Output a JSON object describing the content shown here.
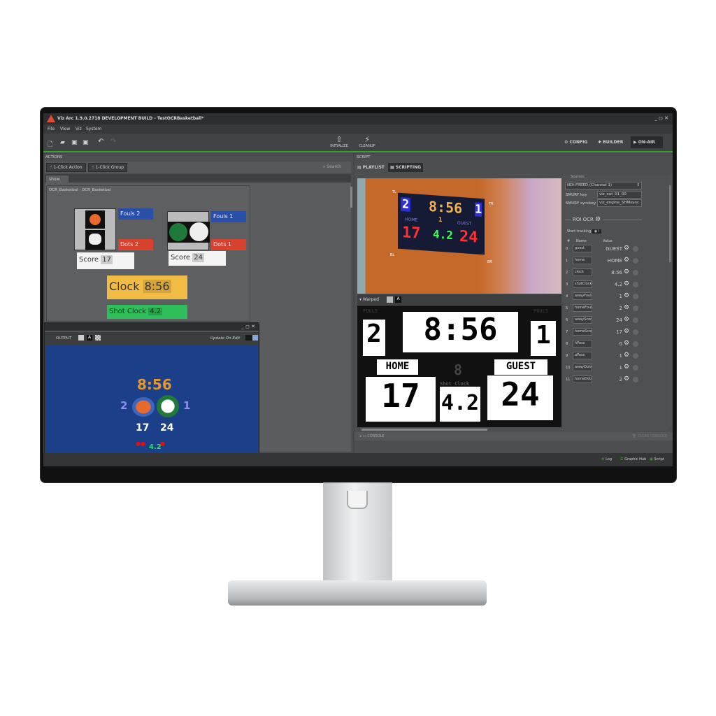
{
  "window": {
    "title": "Viz Arc 1.9.0.2718 DEVELOPMENT BUILD - TestOCRBasketball*",
    "controls": "_ ◻ ✕"
  },
  "menu": [
    "File",
    "View",
    "Viz",
    "System"
  ],
  "toolbar": {
    "initialize": "INITIALIZE",
    "cleanup": "CLEANUP",
    "config": "CONFIG",
    "builder": "BUILDER",
    "on_air": "ON-AIR"
  },
  "actions": {
    "header": "ACTIONS",
    "one_click_action": "1-Click Action",
    "one_click_group": "1-Click Group",
    "search_placeholder": "Search",
    "tab": "show",
    "breadcrumb": "OCR_Basketbal  ·  OCR_Basketbal",
    "home": {
      "fouls_label": "Fouls",
      "fouls": "2",
      "dots_label": "Dots",
      "dots": "2",
      "score_label": "Score",
      "score": "17"
    },
    "guest": {
      "fouls_label": "Fouls",
      "fouls": "1",
      "dots_label": "Dots",
      "dots": "1",
      "score_label": "Score",
      "score": "24"
    },
    "clock_label": "Clock",
    "clock": "8:56",
    "shot_clock_label": "Shot Clock",
    "shot_clock": "4.2"
  },
  "output": {
    "label": "OUTPUT",
    "update_on_edit": "Update On-Edit",
    "clock": "8:56",
    "home_fouls": "2",
    "guest_fouls": "1",
    "home_score": "17",
    "guest_score": "24",
    "shot_clock": "4.2"
  },
  "script": {
    "header": "SCRIPT",
    "playlist": "PLAYLIST",
    "scripting": "SCRIPTING",
    "sources_label": "Sources",
    "source": "NDI-FREED (Channel 1)",
    "smurf_key_label": "SMURF key",
    "smurf_key": "viz_out_01_00",
    "smurf_synckey_label": "SMURF synckey",
    "smurf_synckey": "viz_engine_SHMsync",
    "roi_title": "ROI OCR",
    "start_tracking": "Start tracking",
    "col_num": "#",
    "col_name": "Name",
    "col_value": "Value",
    "rois": [
      {
        "n": "0",
        "name": "guest",
        "value": "GUEST"
      },
      {
        "n": "1",
        "name": "home",
        "value": "HOME"
      },
      {
        "n": "2",
        "name": "clock",
        "value": "8:56"
      },
      {
        "n": "3",
        "name": "shotClock",
        "value": "4.2"
      },
      {
        "n": "4",
        "name": "awayFouls",
        "value": "1"
      },
      {
        "n": "5",
        "name": "homeFouls",
        "value": "2"
      },
      {
        "n": "6",
        "name": "awayScore",
        "value": "24"
      },
      {
        "n": "7",
        "name": "homeScore",
        "value": "17"
      },
      {
        "n": "8",
        "name": "hPoss",
        "value": "0"
      },
      {
        "n": "9",
        "name": "aPoss",
        "value": "1"
      },
      {
        "n": "10",
        "name": "awayDots",
        "value": "1"
      },
      {
        "n": "11",
        "name": "homeDots",
        "value": "2"
      }
    ],
    "camera": {
      "corners": [
        "TL",
        "TR",
        "BL",
        "BR"
      ],
      "home_fouls": "2",
      "clock": "8:56",
      "guest_fouls": "1",
      "home": "HOME",
      "guest": "GUEST",
      "period": "1",
      "home_score": "17",
      "shot_clock": "4.2",
      "guest_score": "24"
    },
    "warped": {
      "label": "Warped",
      "fouls": "FOULS",
      "home_fouls": "2",
      "clock": "8:56",
      "guest_fouls": "1",
      "home": "HOME",
      "guest": "GUEST",
      "period": "8",
      "shot_clock_label": "Shot Clock",
      "home_score": "17",
      "shot_clock": "4.2",
      "guest_score": "24"
    },
    "console": "CONSOLE",
    "clear_console": "CLEAR CONSOLE"
  },
  "status": {
    "log": "Log",
    "graphic_hub": "Graphic Hub",
    "script": "Script"
  },
  "colors": {
    "accent_green": "#3fa12a",
    "fouls_blue": "#2a4fa8",
    "dots_red": "#d8412c",
    "clock_yellow": "#f1bc45",
    "shot_green": "#2fbf5a",
    "output_bg": "#1c3f8a"
  }
}
